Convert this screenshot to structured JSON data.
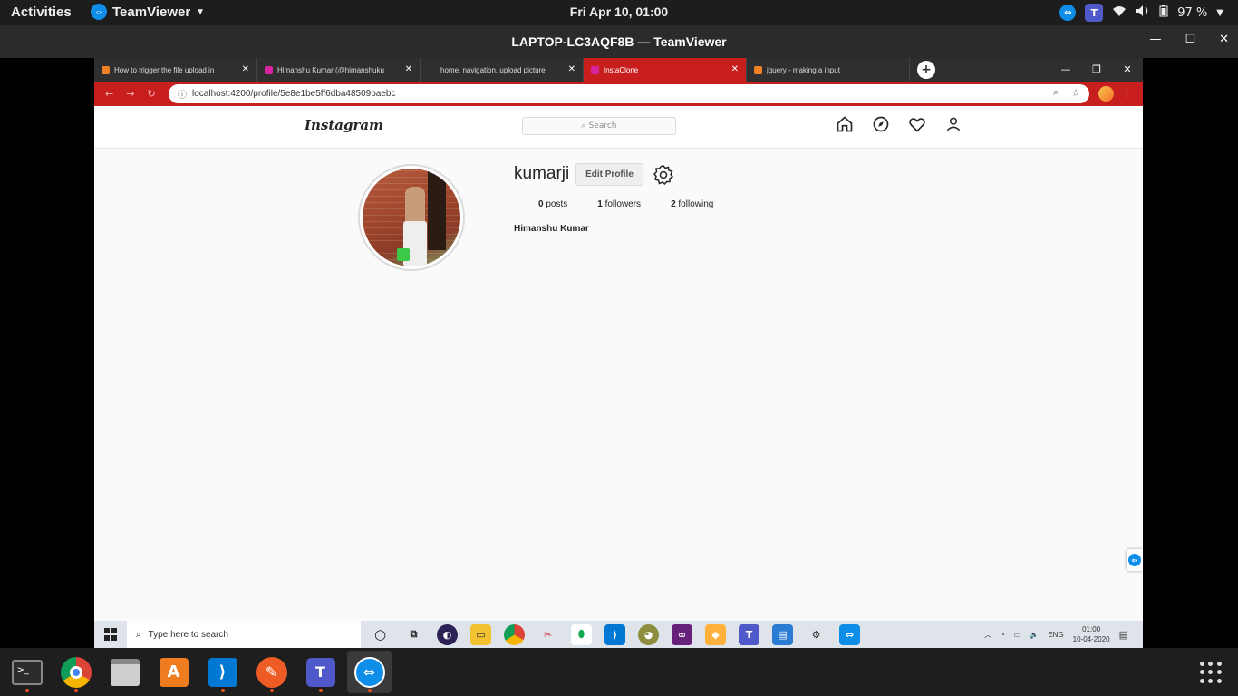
{
  "gnome": {
    "activities": "Activities",
    "app_name": "TeamViewer",
    "datetime": "Fri Apr 10, 01:00",
    "battery": "97 %"
  },
  "window": {
    "title": "LAPTOP-LC3AQF8B — TeamViewer"
  },
  "browser": {
    "tabs": [
      {
        "label": "How to trigger the file upload in"
      },
      {
        "label": "Himanshu Kumar (@himanshuku"
      },
      {
        "label": "home, navigation, upload picture"
      },
      {
        "label": "InstaClone"
      },
      {
        "label": "jquery - making a input"
      }
    ],
    "url": "localhost:4200/profile/5e8e1be5ff6dba48509baebc"
  },
  "instagram": {
    "logo": "Instagram",
    "search_placeholder": "Search"
  },
  "profile": {
    "username": "kumarji",
    "edit_label": "Edit Profile",
    "posts_count": "0",
    "posts_label": "posts",
    "followers_count": "1",
    "followers_label": "followers",
    "following_count": "2",
    "following_label": "following",
    "full_name": "Himanshu Kumar"
  },
  "windows": {
    "search_placeholder": "Type here to search",
    "lang": "ENG",
    "time": "01:00",
    "date": "10-04-2020"
  }
}
